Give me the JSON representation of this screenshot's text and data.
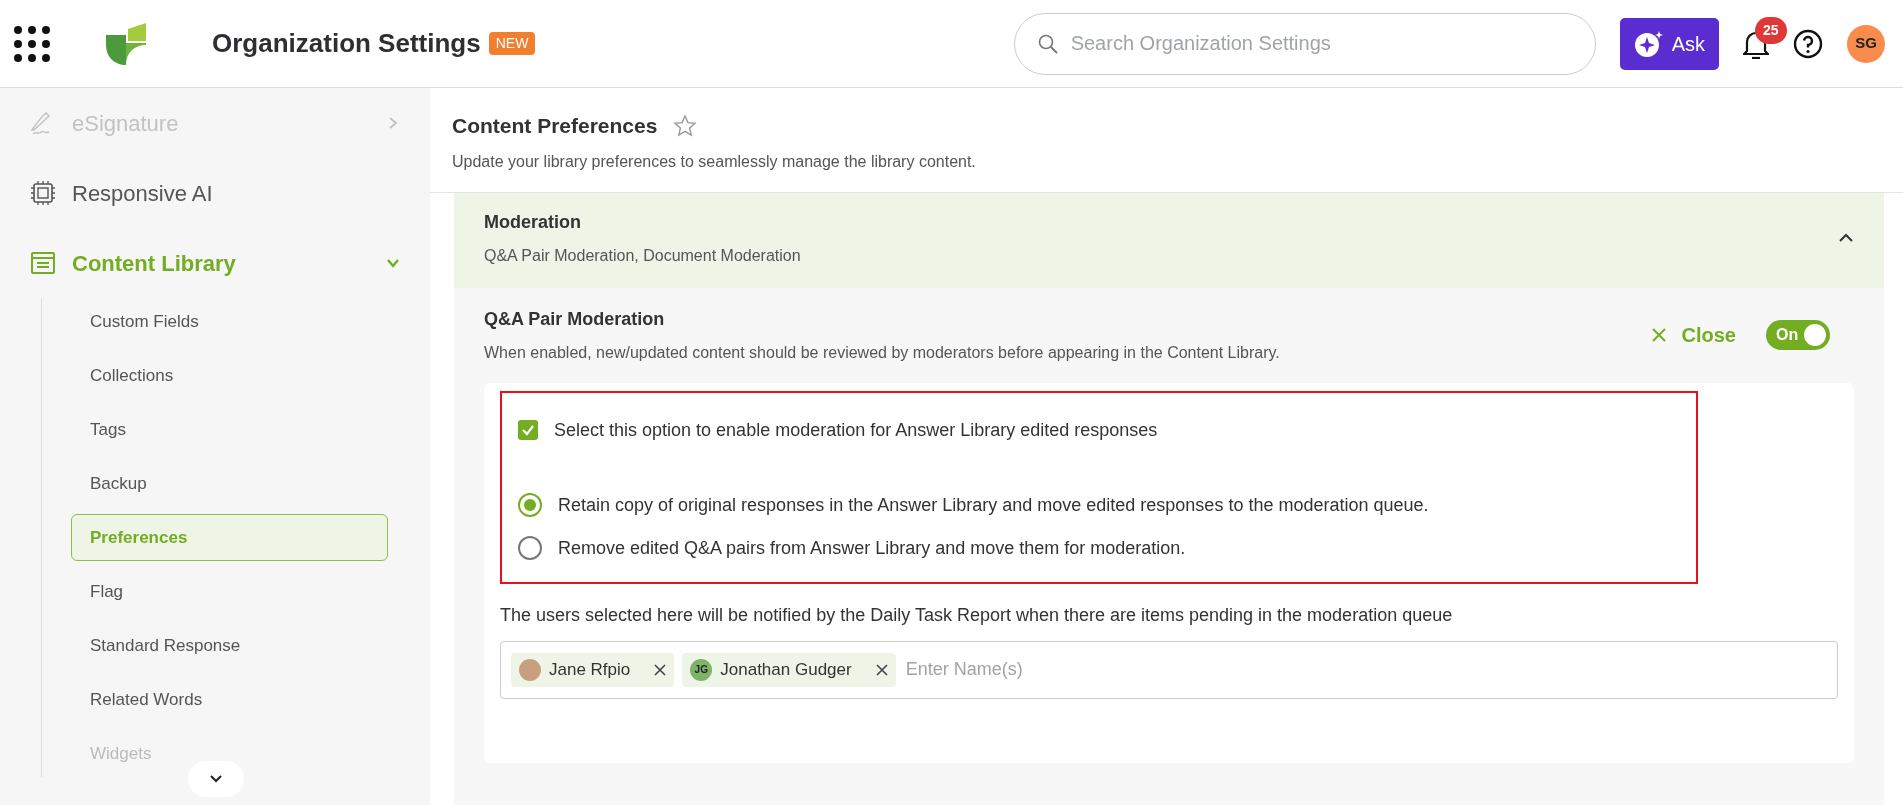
{
  "header": {
    "title": "Organization Settings",
    "badge": "NEW",
    "search": {
      "placeholder": "Search Organization Settings"
    },
    "ask_label": "Ask",
    "notification_count": "25",
    "avatar_initials": "SG"
  },
  "sidebar": {
    "items": [
      {
        "kind": "signature",
        "label": "eSignature",
        "disabled": true,
        "expanded": false,
        "selected": false
      },
      {
        "kind": "ai",
        "label": "Responsive AI",
        "disabled": false,
        "selected": false
      },
      {
        "kind": "library",
        "label": "Content Library",
        "disabled": false,
        "expanded": true,
        "selected": true,
        "children": [
          {
            "label": "Custom Fields",
            "selected": false,
            "disabled": false
          },
          {
            "label": "Collections",
            "selected": false,
            "disabled": false
          },
          {
            "label": "Tags",
            "selected": false,
            "disabled": false
          },
          {
            "label": "Backup",
            "selected": false,
            "disabled": false
          },
          {
            "label": "Preferences",
            "selected": true,
            "disabled": false
          },
          {
            "label": "Flag",
            "selected": false,
            "disabled": false
          },
          {
            "label": "Standard Response",
            "selected": false,
            "disabled": false
          },
          {
            "label": "Related Words",
            "selected": false,
            "disabled": false
          },
          {
            "label": "Widgets",
            "selected": false,
            "disabled": true
          }
        ]
      }
    ]
  },
  "page": {
    "title": "Content Preferences",
    "starred": false,
    "subtitle": "Update your library preferences to seamlessly manage the library content."
  },
  "accordion": {
    "title": "Moderation",
    "subtitle": "Q&A Pair Moderation, Document Moderation",
    "expanded": true
  },
  "section": {
    "title": "Q&A Pair Moderation",
    "description": "When enabled, new/updated content should be reviewed by moderators before appearing in the Content Library.",
    "close_label": "Close",
    "toggle": {
      "label": "On",
      "on": true
    }
  },
  "options": {
    "checkbox": {
      "label": "Select this option to enable moderation for Answer Library edited responses",
      "checked": true
    },
    "radios": [
      {
        "label": "Retain copy of original responses in the Answer Library and move edited responses to the moderation queue.",
        "selected": true
      },
      {
        "label": "Remove edited Q&A pairs from Answer Library and move them for moderation.",
        "selected": false
      }
    ]
  },
  "notify": {
    "text": "The users selected here will be notified by the Daily Task Report when there are items pending in the moderation queue",
    "users": [
      {
        "kind": "photo",
        "name": "Jane Rfpio"
      },
      {
        "kind": "initials",
        "name": "Jonathan Gudger",
        "initials": "JG"
      }
    ],
    "placeholder": "Enter Name(s)"
  }
}
